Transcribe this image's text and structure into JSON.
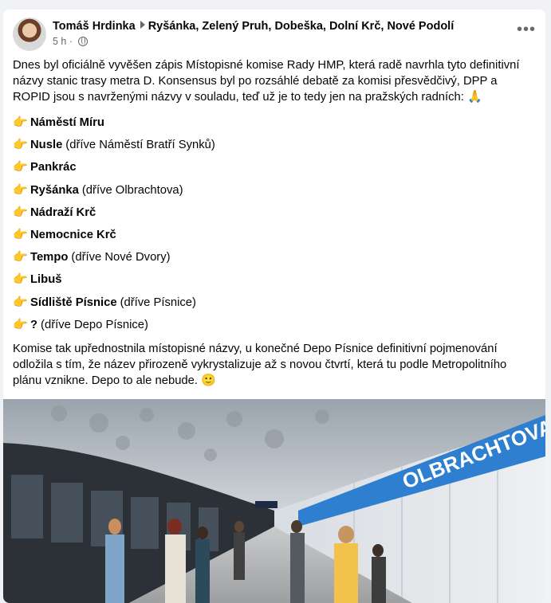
{
  "post": {
    "author": "Tomáš Hrdinka",
    "location": "Ryšánka, Zelený Pruh, Dobeška, Dolní Krč, Nové Podolí",
    "time": "5 h",
    "separator": "·",
    "more": "•••",
    "intro": "Dnes byl oficiálně vyvěšen zápis Místopisné komise Rady HMP, která radě navrhla tyto definitivní názvy stanic trasy metra D. Konsensus byl po rozsáhlé debatě za komisi přesvědčivý, DPP a ROPID jsou s navrženými názvy v souladu, teď už je to tedy jen na pražských radních:",
    "intro_emoji": "🙏",
    "list_bullet": "👉",
    "stations": [
      {
        "name": "Náměstí Míru",
        "note": ""
      },
      {
        "name": "Nusle",
        "note": "(dříve Náměstí Bratří Synků)"
      },
      {
        "name": "Pankrác",
        "note": ""
      },
      {
        "name": "Ryšánka",
        "note": "(dříve Olbrachtova)"
      },
      {
        "name": "Nádraží Krč",
        "note": ""
      },
      {
        "name": "Nemocnice Krč",
        "note": ""
      },
      {
        "name": "Tempo",
        "note": "(dříve Nové Dvory)"
      },
      {
        "name": "Libuš",
        "note": ""
      },
      {
        "name": "Sídliště Písnice",
        "note": "(dříve Písnice)"
      },
      {
        "name": "?",
        "note": "(dříve Depo Písnice)"
      }
    ],
    "outro": "Komise tak upřednostnila místopisné názvy, u konečné Depo Písnice definitivní pojmenování odložila s tím, že název přirozeně vykrystalizuje až s novou čtvrtí, která tu podle Metropolitního plánu vznikne. Depo to ale nebude.",
    "outro_emoji": "🙂"
  },
  "photo": {
    "sign": "OLBRACHTOVA"
  }
}
